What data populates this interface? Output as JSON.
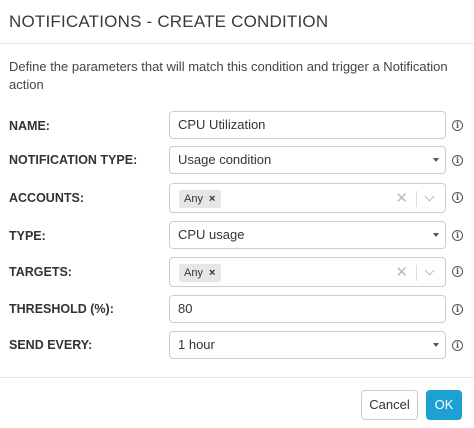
{
  "dialog": {
    "title": "NOTIFICATIONS - CREATE CONDITION",
    "description": "Define the parameters that will match this condition and trigger a Notification action"
  },
  "fields": {
    "name": {
      "label": "NAME:",
      "value": "CPU Utilization"
    },
    "notification_type": {
      "label": "NOTIFICATION TYPE:",
      "value": "Usage condition"
    },
    "accounts": {
      "label": "ACCOUNTS:",
      "tag": "Any"
    },
    "type": {
      "label": "TYPE:",
      "value": "CPU usage"
    },
    "targets": {
      "label": "TARGETS:",
      "tag": "Any"
    },
    "threshold": {
      "label": "THRESHOLD (%):",
      "value": "80"
    },
    "send_every": {
      "label": "SEND EVERY:",
      "value": "1 hour"
    }
  },
  "icons": {
    "tag_remove": "×",
    "clear": "✕",
    "info": "i"
  },
  "buttons": {
    "cancel": "Cancel",
    "ok": "OK"
  },
  "colors": {
    "primary": "#1da1d2",
    "border": "#cccccc",
    "tag_background": "#e6e6e6"
  }
}
